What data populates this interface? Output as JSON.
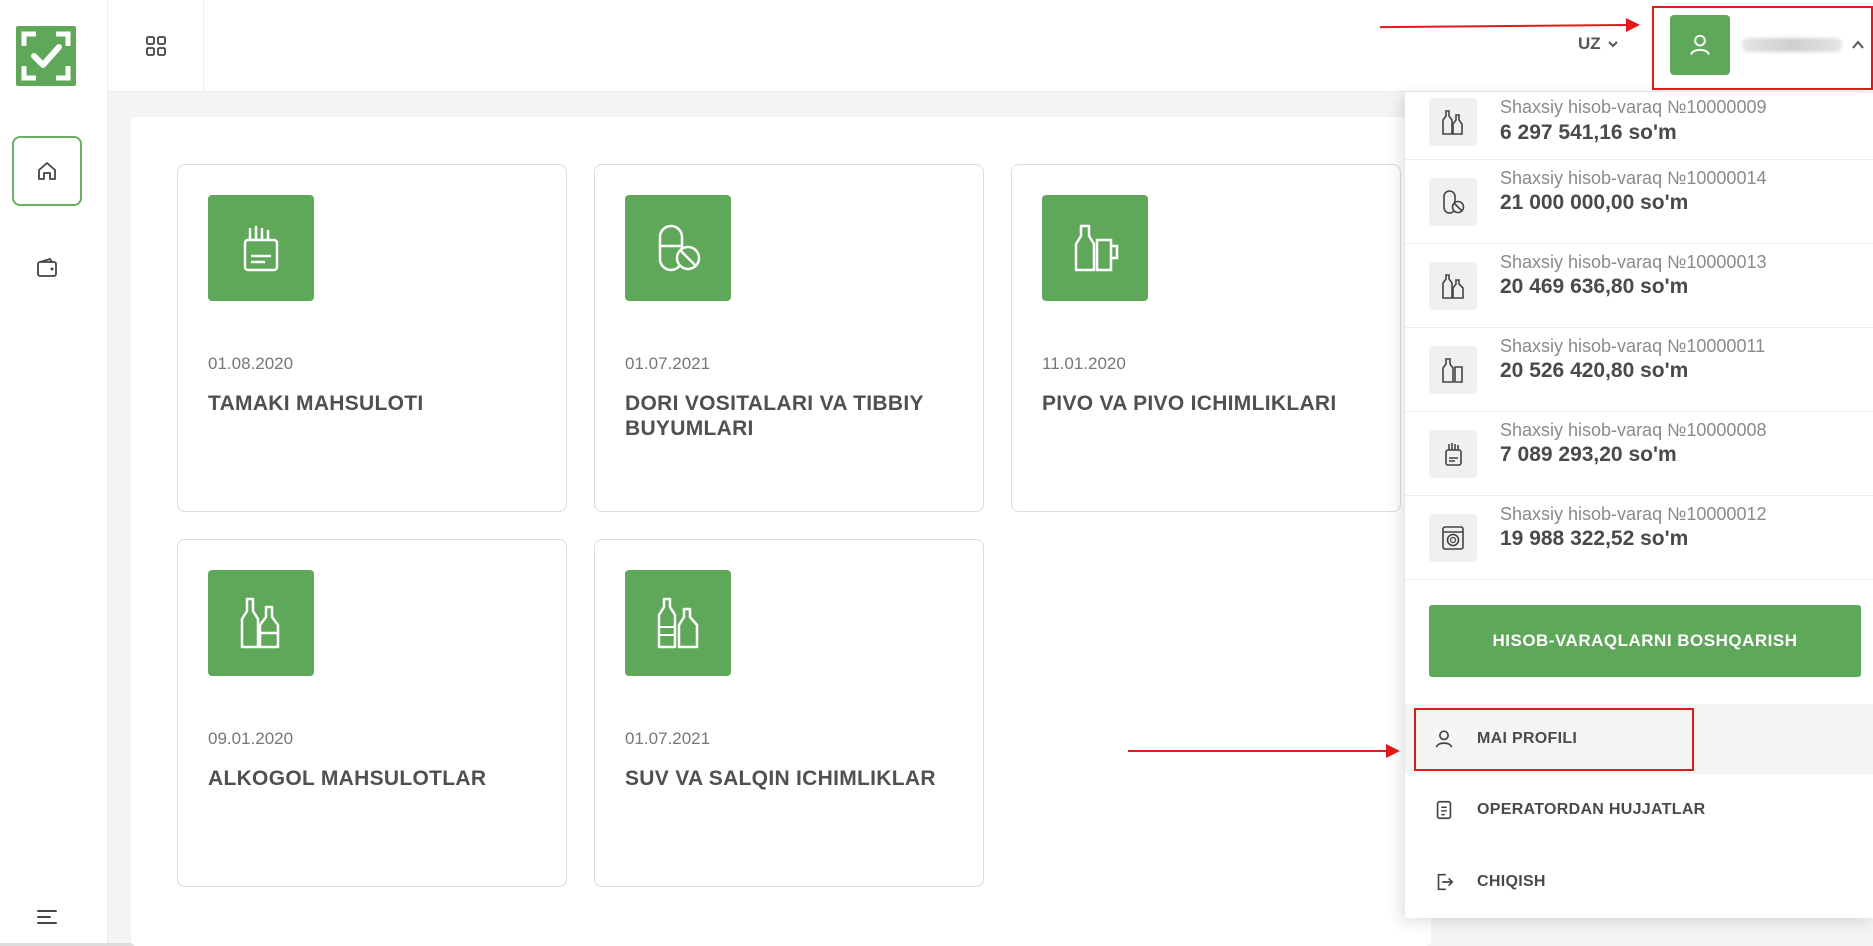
{
  "colors": {
    "accent": "#5fa85a",
    "annotation": "#e01a1a"
  },
  "header": {
    "language": "UZ"
  },
  "cards": [
    {
      "date": "01.08.2020",
      "title": "TAMAKI MAHSULOTI",
      "icon": "cigarette-pack-icon"
    },
    {
      "date": "01.07.2021",
      "title": "DORI VOSITALARI VA TIBBIY BUYUMLARI",
      "icon": "pill-icon"
    },
    {
      "date": "11.01.2020",
      "title": "PIVO VA PIVO ICHIMLIKLARI",
      "icon": "beer-icon"
    },
    {
      "date": "09.01.2020",
      "title": "ALKOGOL MAHSULOTLAR",
      "icon": "alcohol-bottles-icon"
    },
    {
      "date": "01.07.2021",
      "title": "SUV VA SALQIN ICHIMLIKLAR",
      "icon": "water-bottles-icon"
    }
  ],
  "dropdown": {
    "accounts": [
      {
        "label": "Shaxsiy hisob-varaq №10000009",
        "amount": "6 297 541,16 so'm",
        "icon": "alcohol-bottles-icon"
      },
      {
        "label": "Shaxsiy hisob-varaq №10000014",
        "amount": "21 000 000,00 so'm",
        "icon": "pill-icon"
      },
      {
        "label": "Shaxsiy hisob-varaq №10000013",
        "amount": "20 469 636,80 so'm",
        "icon": "water-bottles-icon"
      },
      {
        "label": "Shaxsiy hisob-varaq №10000011",
        "amount": "20 526 420,80 so'm",
        "icon": "beer-icon"
      },
      {
        "label": "Shaxsiy hisob-varaq №10000008",
        "amount": "7 089 293,20 so'm",
        "icon": "cigarette-pack-icon"
      },
      {
        "label": "Shaxsiy hisob-varaq №10000012",
        "amount": "19 988 322,52 so'm",
        "icon": "washing-machine-icon"
      }
    ],
    "manage_button": "HISOB-VARAQLARNI BOSHQARISH",
    "menu": {
      "profile": "MAI PROFILI",
      "documents": "OPERATORDAN HUJJATLAR",
      "logout": "CHIQISH"
    }
  }
}
